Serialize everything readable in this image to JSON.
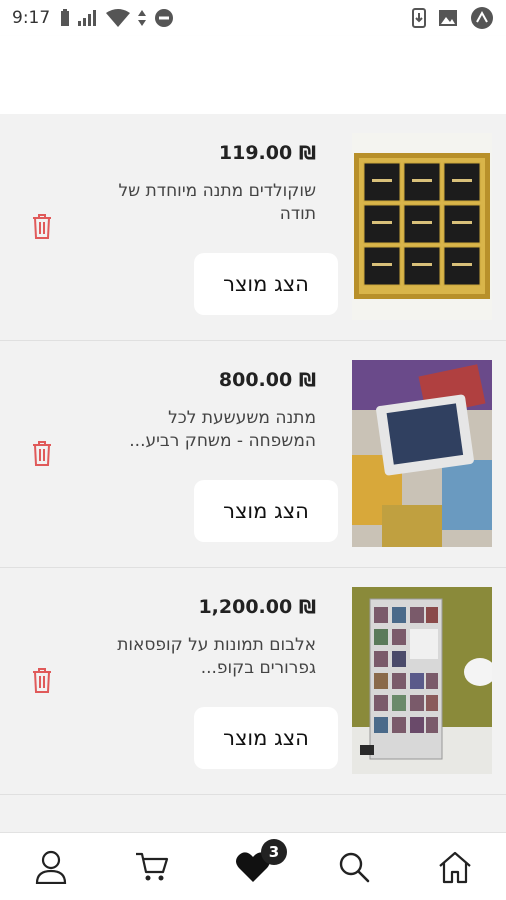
{
  "status_bar": {
    "time": "9:17"
  },
  "items": [
    {
      "price": "₪ 119.00",
      "name": "שוקולדים מתנה מיוחדת של תודה",
      "button": "הצג מוצר"
    },
    {
      "price": "₪ 800.00",
      "name": "מתנה משעשעת לכל המשפחה - משחק רביע...",
      "button": "הצג מוצר"
    },
    {
      "price": "₪ 1,200.00",
      "name": "אלבום תמונות על קופסאות גפרורים בקופ...",
      "button": "הצג מוצר"
    }
  ],
  "bottom_nav": {
    "items": [
      "profile-icon",
      "cart-icon",
      "heart-icon",
      "search-icon",
      "home-icon"
    ],
    "wishlist_count": "3"
  },
  "colors": {
    "trash": "#e05a5a",
    "background": "#f2f2f2"
  }
}
